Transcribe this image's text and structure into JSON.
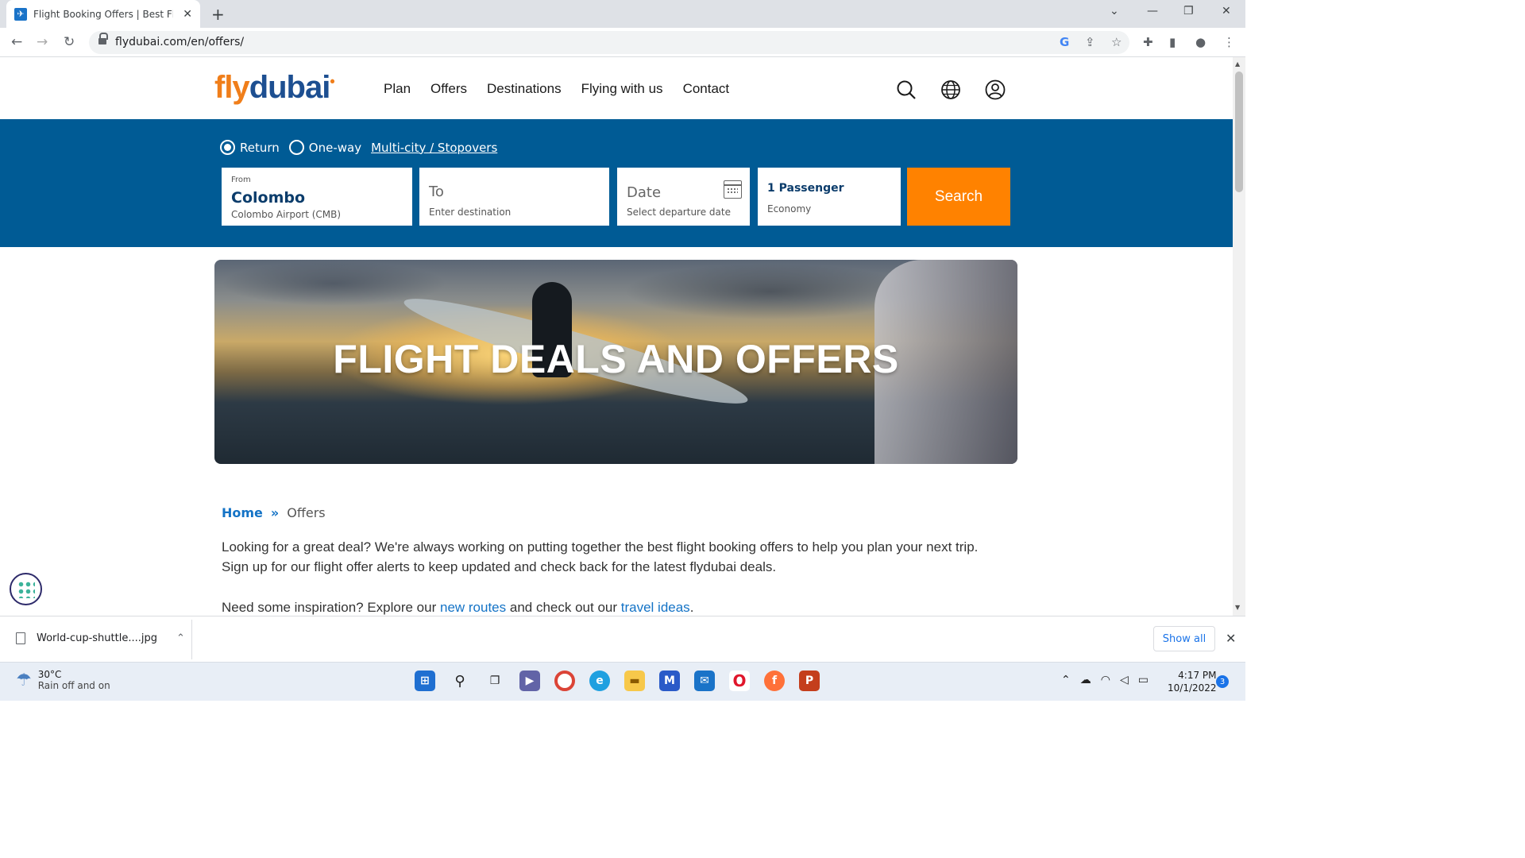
{
  "browser": {
    "tab_title": "Flight Booking Offers | Best Fligh",
    "url": "flydubai.com/en/offers/"
  },
  "site": {
    "logo_fly": "fly",
    "logo_dubai": "dubai",
    "nav": [
      "Plan",
      "Offers",
      "Destinations",
      "Flying with us",
      "Contact"
    ]
  },
  "booking": {
    "trip_types": [
      "Return",
      "One-way"
    ],
    "selected_trip": "Return",
    "multicity_link": "Multi-city / Stopovers",
    "from": {
      "label": "From",
      "city": "Colombo",
      "airport": "Colombo Airport (CMB)"
    },
    "to": {
      "title": "To",
      "hint": "Enter destination"
    },
    "date": {
      "title": "Date",
      "hint": "Select departure date"
    },
    "passengers": {
      "title": "1 Passenger",
      "cabin": "Economy"
    },
    "search_label": "Search"
  },
  "hero": {
    "title": "FLIGHT DEALS AND OFFERS"
  },
  "breadcrumb": {
    "home": "Home",
    "separator": "»",
    "current": "Offers"
  },
  "content": {
    "para1": "Looking for a great deal? We're always working on putting together the best flight booking offers to help you plan your next trip. Sign up for our flight offer alerts to keep updated and check back for the latest flydubai deals.",
    "para2_before": "Need some inspiration? Explore our ",
    "para2_link1": "new routes",
    "para2_middle": " and check out our ",
    "para2_link2": "travel ideas",
    "para2_after": "."
  },
  "downloads": {
    "file": "World-cup-shuttle....jpg",
    "show_all": "Show all"
  },
  "taskbar": {
    "temperature": "30°C",
    "weather": "Rain off and on",
    "time": "4:17 PM",
    "date": "10/1/2022",
    "notifications": "3"
  },
  "colors": {
    "brand_blue": "#005b95",
    "brand_orange": "#ff8200",
    "link_blue": "#1473c6"
  }
}
